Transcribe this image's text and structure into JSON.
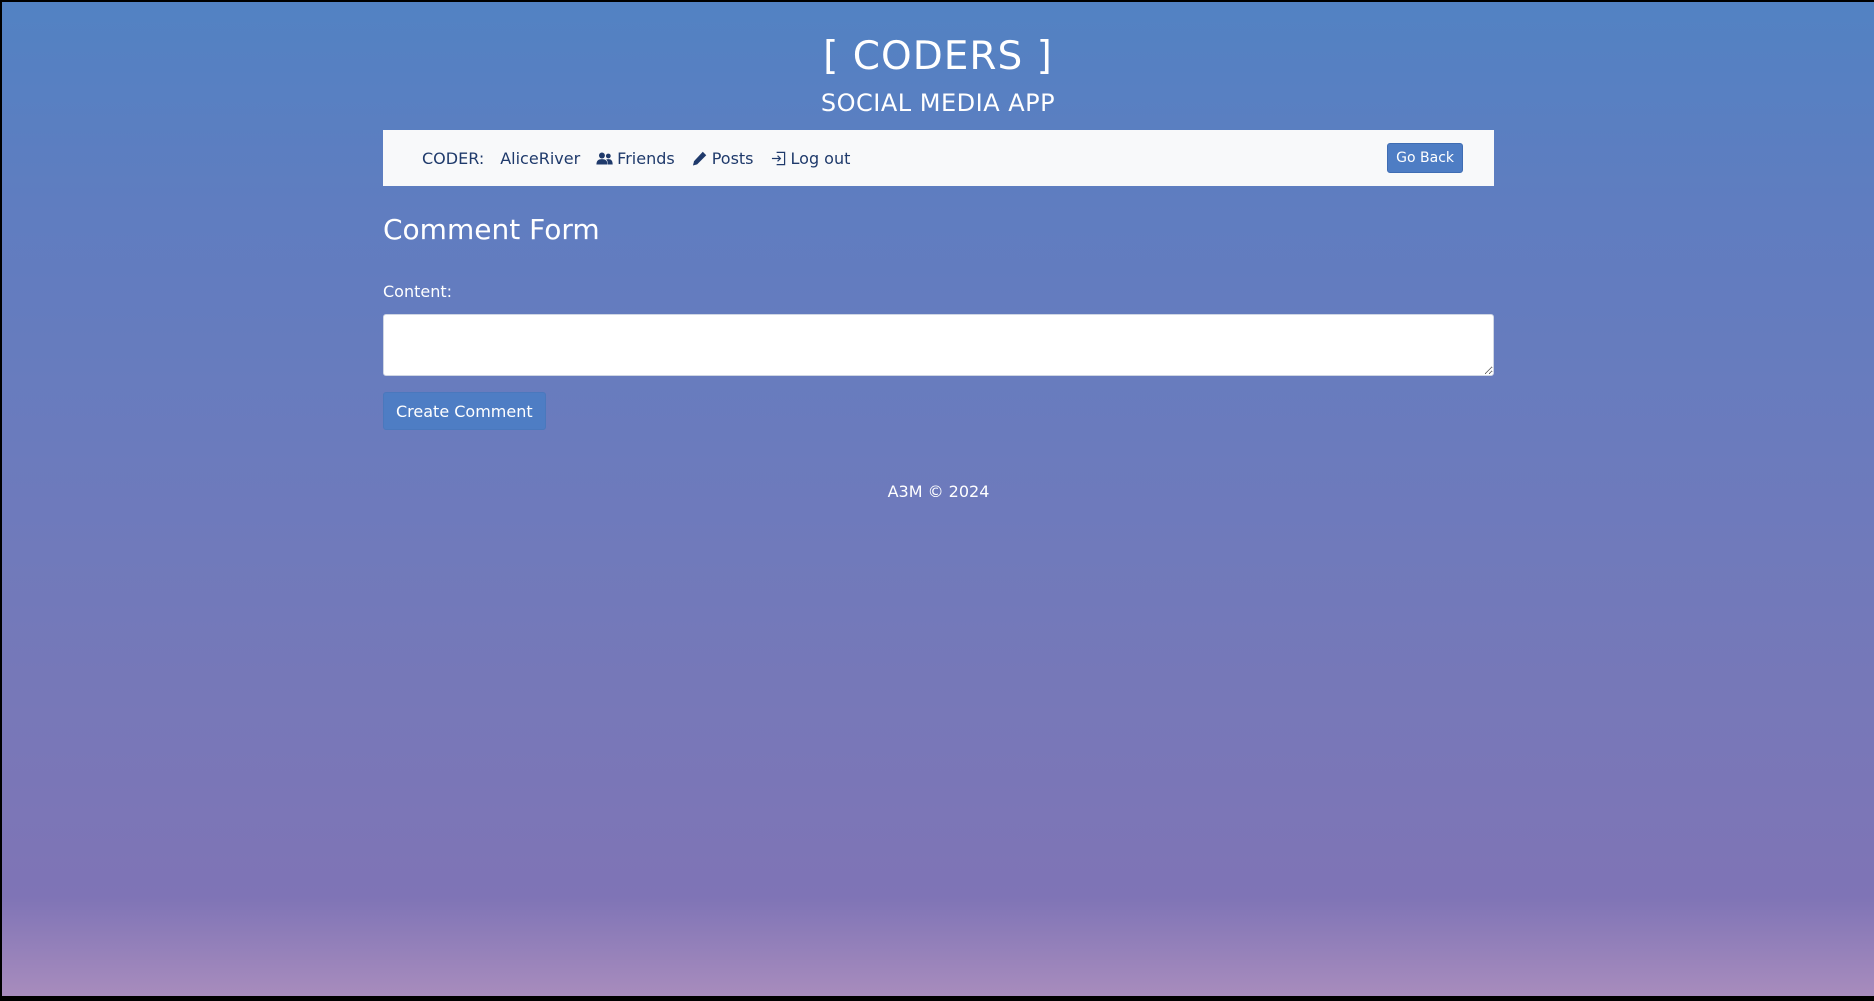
{
  "header": {
    "title": "[ CODERS ]",
    "subtitle": "SOCIAL MEDIA APP"
  },
  "navbar": {
    "coder_label": "CODER:",
    "username": "AliceRiver",
    "friends_label": "Friends",
    "posts_label": "Posts",
    "logout_label": "Log out",
    "go_back_label": "Go Back",
    "icons": {
      "friends": "users-icon",
      "posts": "pen-icon",
      "logout": "sign-out-icon"
    }
  },
  "form": {
    "title": "Comment Form",
    "content_label": "Content:",
    "content_value": "",
    "submit_label": "Create Comment"
  },
  "footer": {
    "text": "A3M © 2024"
  },
  "colors": {
    "gradient_top": "#5282c3",
    "gradient_bottom": "#a88cbd",
    "navbar_bg": "#f8f9fa",
    "nav_text": "#1f3a6b",
    "button_bg": "#4e7dc4"
  }
}
